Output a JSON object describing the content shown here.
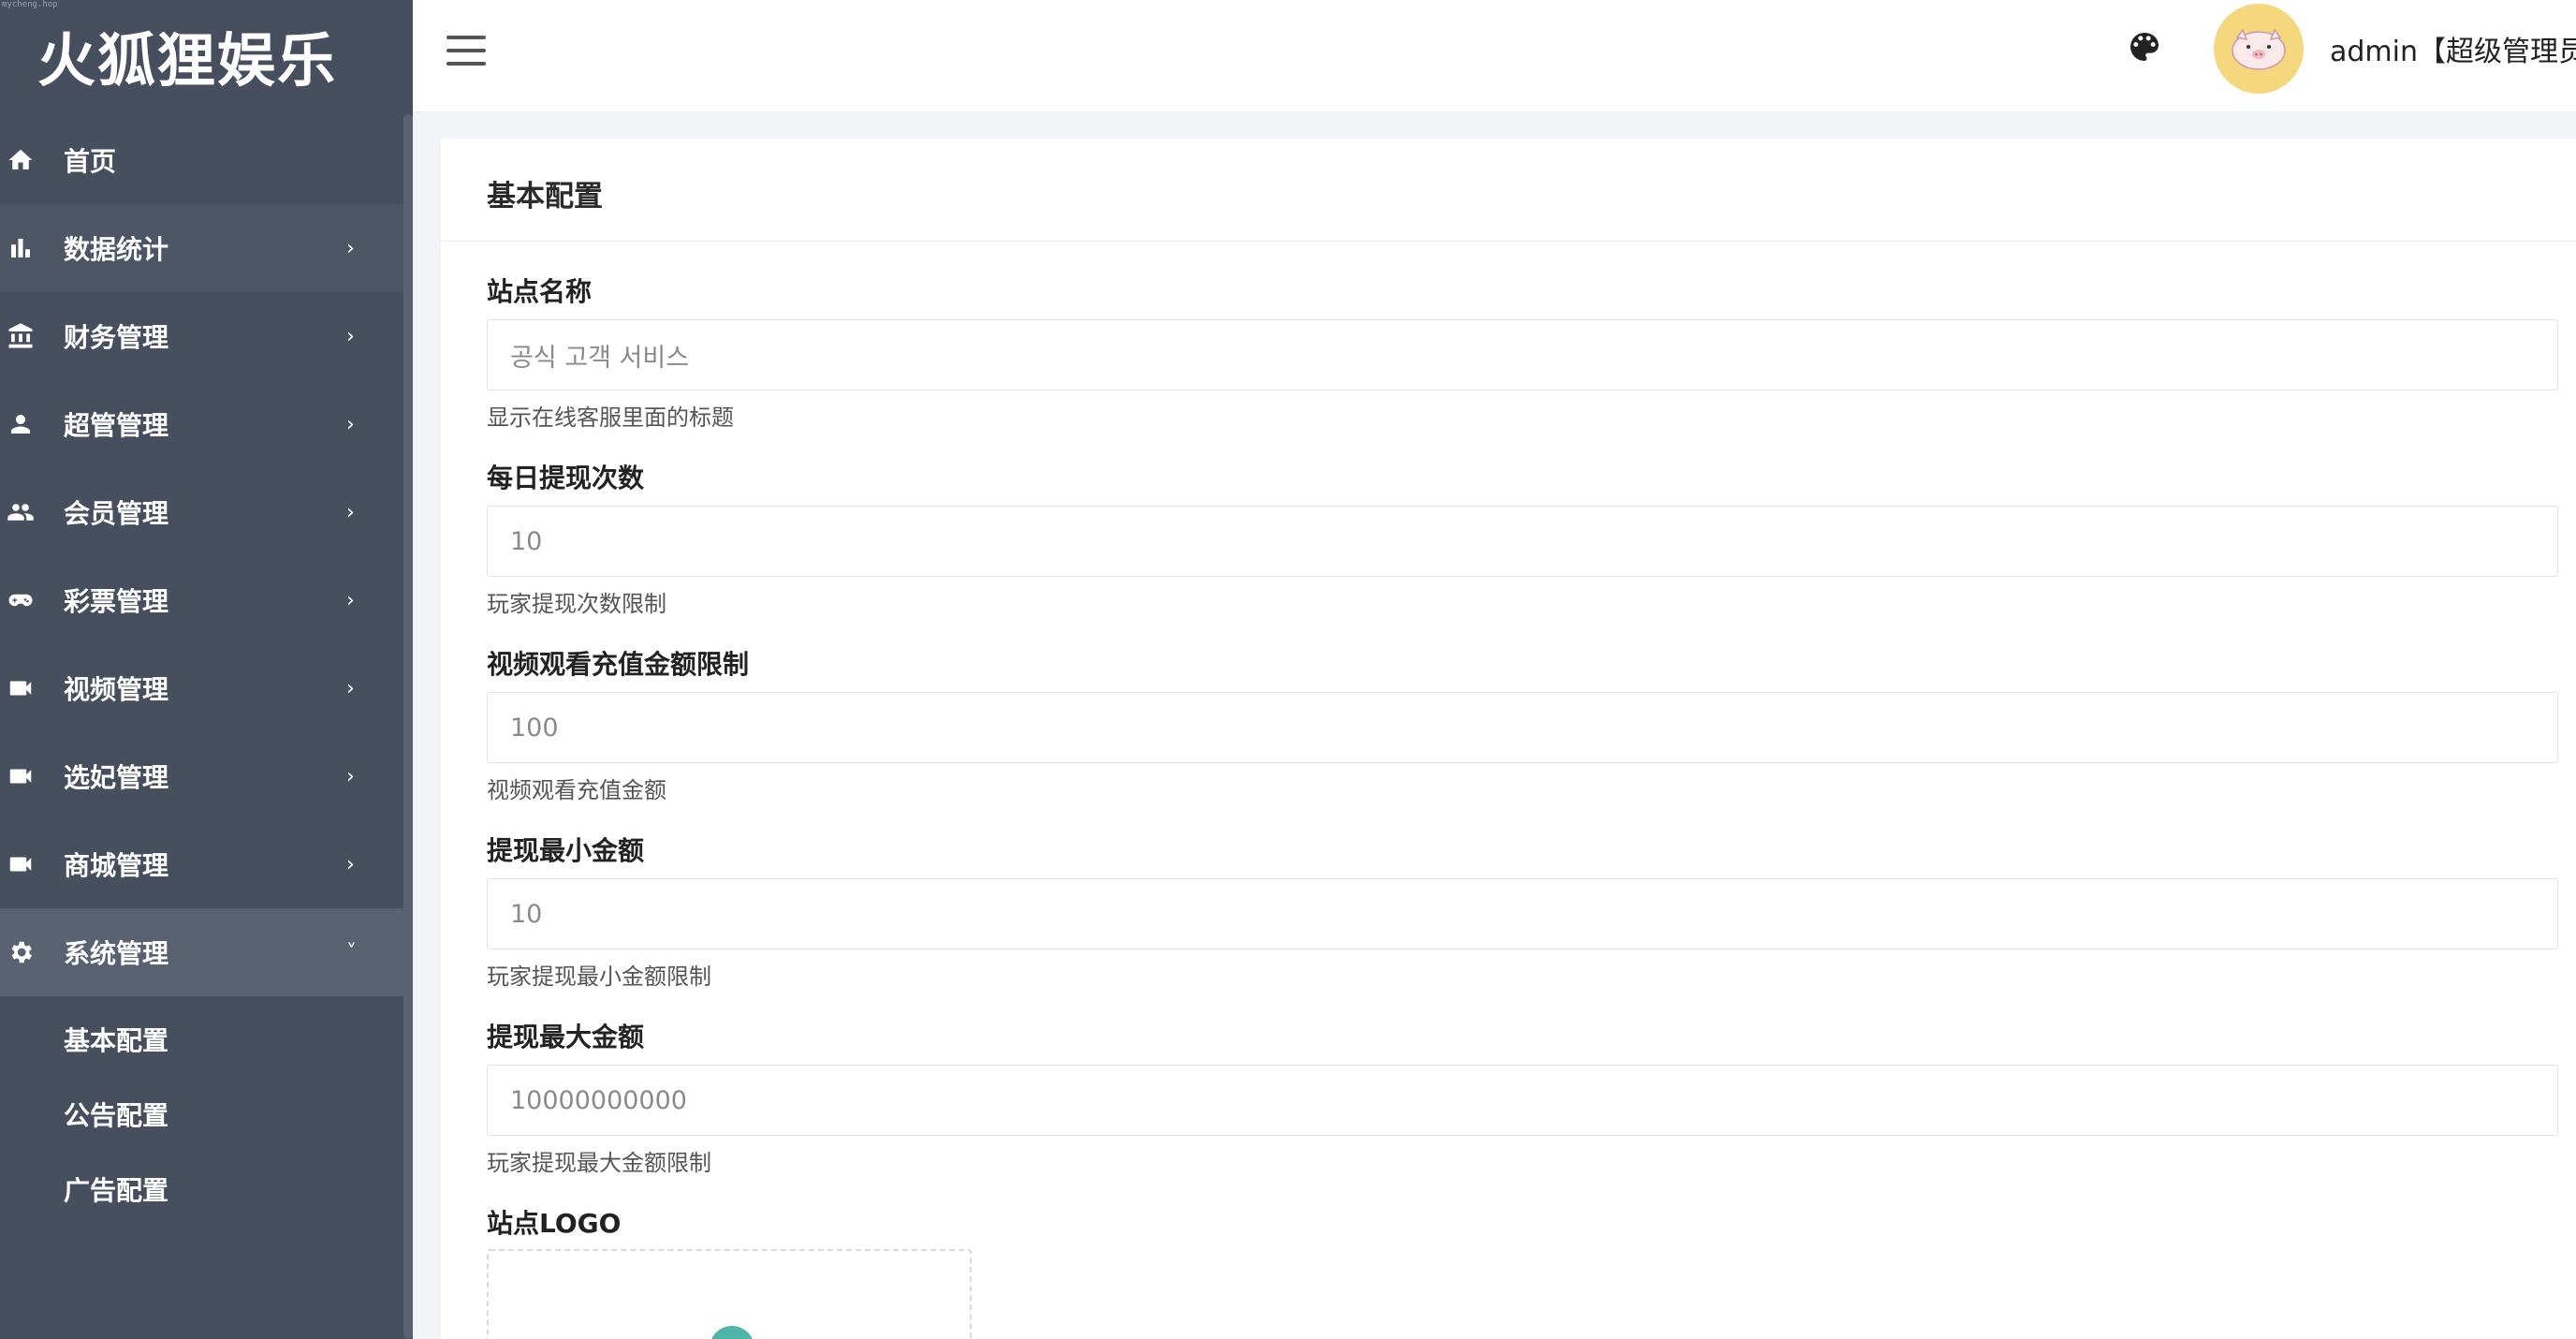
{
  "sidebar": {
    "brand_title": "火狐狸娱乐",
    "brand_tiny_text": "mycheng.hop",
    "menu": [
      {
        "label": "首页",
        "icon": "home-icon",
        "has_arrow": false,
        "arrow": ""
      },
      {
        "label": "数据统计",
        "icon": "bar-chart-icon",
        "has_arrow": true,
        "arrow": "›"
      },
      {
        "label": "财务管理",
        "icon": "bank-icon",
        "has_arrow": true,
        "arrow": "›"
      },
      {
        "label": "超管管理",
        "icon": "person-icon",
        "has_arrow": true,
        "arrow": "›"
      },
      {
        "label": "会员管理",
        "icon": "group-icon",
        "has_arrow": true,
        "arrow": "›"
      },
      {
        "label": "彩票管理",
        "icon": "gamepad-icon",
        "has_arrow": true,
        "arrow": "›"
      },
      {
        "label": "视频管理",
        "icon": "video-camera-icon",
        "has_arrow": true,
        "arrow": "›"
      },
      {
        "label": "选妃管理",
        "icon": "video-camera-icon",
        "has_arrow": true,
        "arrow": "›"
      },
      {
        "label": "商城管理",
        "icon": "video-camera-icon",
        "has_arrow": true,
        "arrow": "›"
      },
      {
        "label": "系统管理",
        "icon": "gear-icon",
        "has_arrow": true,
        "arrow": "˅"
      }
    ],
    "submenu": [
      "基本配置",
      "公告配置",
      "广告配置"
    ]
  },
  "header": {
    "username": "admin【超级管理员】",
    "theme_icon": "palette-icon",
    "avatar_icon": "pig-avatar"
  },
  "form": {
    "title": "基本配置",
    "fields": [
      {
        "label": "站点名称",
        "value": "공식 고객 서비스",
        "help": "显示在线客服里面的标题"
      },
      {
        "label": "每日提现次数",
        "value": "10",
        "help": "玩家提现次数限制"
      },
      {
        "label": "视频观看充值金额限制",
        "value": "100",
        "help": "视频观看充值金额"
      },
      {
        "label": "提现最小金额",
        "value": "10",
        "help": "玩家提现最小金额限制"
      },
      {
        "label": "提现最大金额",
        "value": "10000000000",
        "help": "玩家提现最大金额限制"
      }
    ],
    "logo_label": "站点LOGO"
  },
  "colors": {
    "sidebar_bg": "#474f5f",
    "accent": "#4db6a8",
    "avatar_bg": "#f5d77e"
  }
}
